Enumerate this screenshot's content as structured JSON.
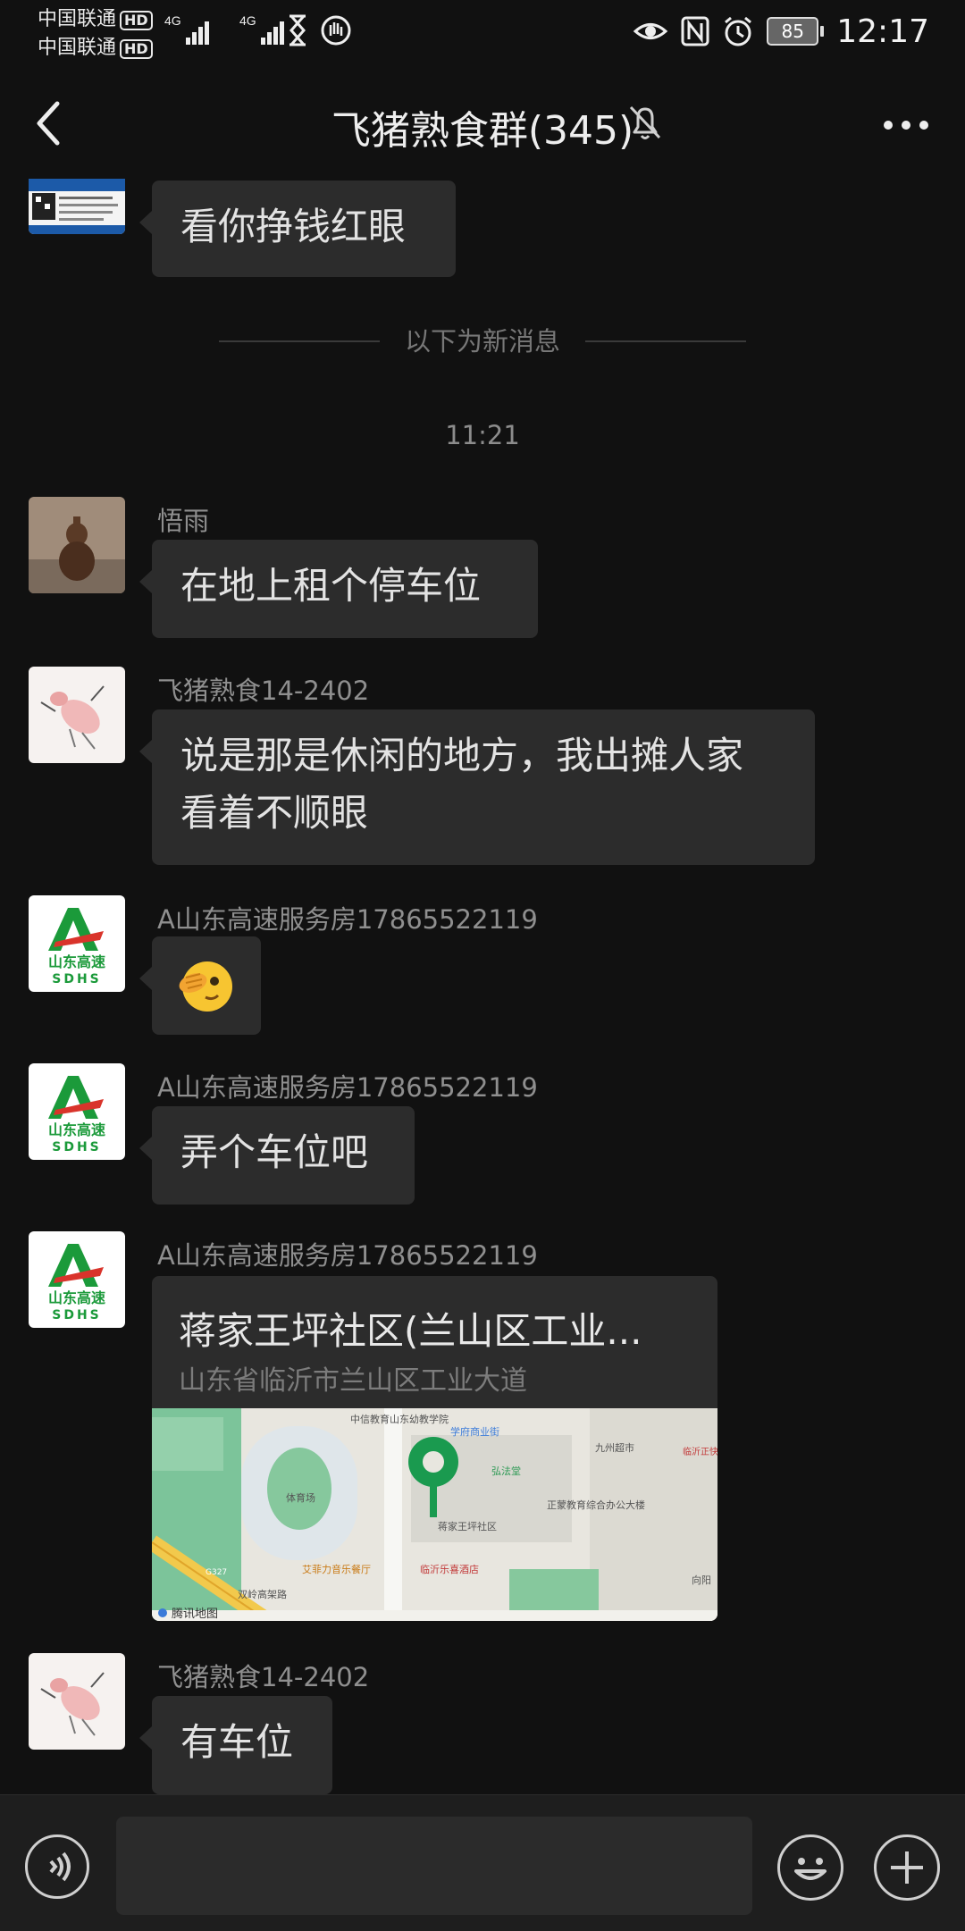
{
  "status_bar": {
    "carrier1": "中国联通",
    "carrier2": "中国联通",
    "hd_badge": "HD",
    "network": "4G",
    "battery": "85",
    "time": "12:17"
  },
  "header": {
    "title": "飞猪熟食群(345)"
  },
  "messages": {
    "m0": {
      "text": "看你挣钱红眼"
    },
    "divider": "以下为新消息",
    "timestamp": "11:21",
    "m1": {
      "sender": "悟雨",
      "text": "在地上租个停车位"
    },
    "m2": {
      "sender": "飞猪熟食14-2402",
      "line1": "说是那是休闲的地方，我出摊人家",
      "line2": "看着不顺眼"
    },
    "m3": {
      "sender": "A山东高速服务房17865522119",
      "emoji": "face-with-hand-icon"
    },
    "m4": {
      "sender": "A山东高速服务房17865522119",
      "text": "弄个车位吧"
    },
    "m5": {
      "sender": "A山东高速服务房17865522119",
      "location_title": "蒋家王坪社区(兰山区工业...",
      "location_address": "山东省临沂市兰山区工业大道",
      "map_labels": {
        "school": "中信教育山东幼教学院",
        "xuefu": "学府商业街",
        "jiuzhou": "九州超市",
        "linyi": "临沂正快捷宾",
        "hongfatang": "弘法堂",
        "gym": "体育场",
        "zhengjiao": "正蒙教育综合办公大楼",
        "jiangjia": "蒋家王坪社区",
        "restaurant": "艾菲力音乐餐厅",
        "hotel": "临沂乐喜酒店",
        "road_code": "G327",
        "road": "双岭高架路",
        "provider": "腾讯地图",
        "direction": "向阳"
      }
    },
    "m6": {
      "sender": "飞猪熟食14-2402",
      "text": "有车位"
    }
  },
  "colors": {
    "background": "#111111",
    "bubble": "#2c2c2c",
    "map_pin": "#1a9a4f",
    "sdhs_green": "#1b9a3a",
    "sdhs_red": "#d9342b"
  }
}
